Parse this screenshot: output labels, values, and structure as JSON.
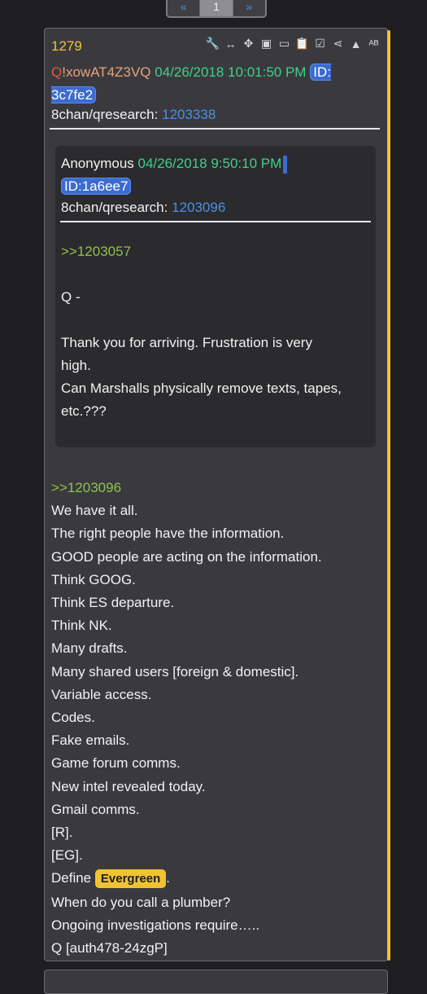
{
  "pager": {
    "prev": "«",
    "current": "1",
    "next": "»"
  },
  "post": {
    "number": "1279",
    "tools": {
      "wrench": "🔧",
      "arrows": "↔",
      "move": "✥",
      "image": "▣",
      "vr": "▭",
      "clipboard": "📋",
      "check": "☑",
      "share": "⋖",
      "up": "▲",
      "spell": "ᴬᴮ"
    },
    "trip_q": "Q",
    "trip_rest": "!xowAT4Z3VQ",
    "datetime": "04/26/2018 10:01:50 PM",
    "id": "ID: 3c7fe2",
    "board": "8chan/qresearch:",
    "board_link": "1203338",
    "quote": {
      "author": "Anonymous",
      "datetime": "04/26/2018 9:50:10 PM",
      "id": "ID:1a6ee7",
      "board": "8chan/qresearch:",
      "board_link": "1203096",
      "reply_ref": ">>1203057",
      "lines": [
        "Q -",
        "Thank you for arriving.  Frustration is very",
        "high.",
        "Can Marshalls physically remove texts, tapes,",
        "etc.???"
      ]
    },
    "reply_ref": ">>1203096",
    "lines": [
      "We have it all.",
      "The right people have the information.",
      "GOOD people are acting on the information.",
      "Think GOOG.",
      "Think ES departure.",
      "Think NK.",
      "Many drafts.",
      "Many shared users [foreign & domestic].",
      "Variable access.",
      "Codes.",
      "Fake emails.",
      "Game forum comms.",
      "New intel revealed today.",
      "Gmail comms.",
      "[R].",
      "[EG]."
    ],
    "define_prefix": "Define",
    "define_badge": "Evergreen",
    "define_suffix": ".",
    "tail_lines": [
      "When do you call a plumber?",
      "Ongoing investigations require…..",
      "Q [auth478-24zgP]"
    ]
  },
  "colors": {
    "accent": "#f1c232",
    "link": "#4a90e2",
    "date": "#3fd08a",
    "green": "#8ec34a"
  }
}
